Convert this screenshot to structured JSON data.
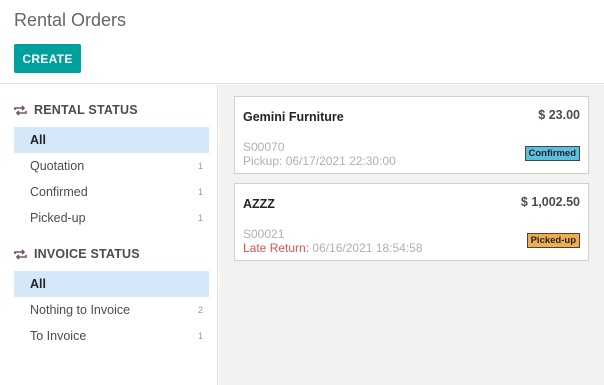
{
  "page": {
    "title": "Rental Orders"
  },
  "toolbar": {
    "create_label": "CREATE"
  },
  "colors": {
    "accent": "#00a09d",
    "confirmed": "#5bc0de",
    "picked_up": "#f0ad4e",
    "late": "#d9534f",
    "active_filter": "#d4e8f9"
  },
  "sidebar": {
    "rental_status": {
      "icon": "repeat-icon",
      "title": "RENTAL STATUS",
      "items": [
        {
          "label": "All",
          "count": ""
        },
        {
          "label": "Quotation",
          "count": "1"
        },
        {
          "label": "Confirmed",
          "count": "1"
        },
        {
          "label": "Picked-up",
          "count": "1"
        }
      ]
    },
    "invoice_status": {
      "icon": "repeat-icon",
      "title": "INVOICE STATUS",
      "items": [
        {
          "label": "All",
          "count": ""
        },
        {
          "label": "Nothing to Invoice",
          "count": "2"
        },
        {
          "label": "To Invoice",
          "count": "1"
        }
      ]
    }
  },
  "cards": [
    {
      "customer": "Gemini Furniture",
      "amount": "$ 23.00",
      "reference": "S00070",
      "date_label": "Pickup:",
      "date": "06/17/2021 22:30:00",
      "status": "Confirmed"
    },
    {
      "customer": "AZZZ",
      "amount": "$ 1,002.50",
      "reference": "S00021",
      "date_label": "Late Return:",
      "date": "06/16/2021 18:54:58",
      "status": "Picked-up"
    }
  ]
}
